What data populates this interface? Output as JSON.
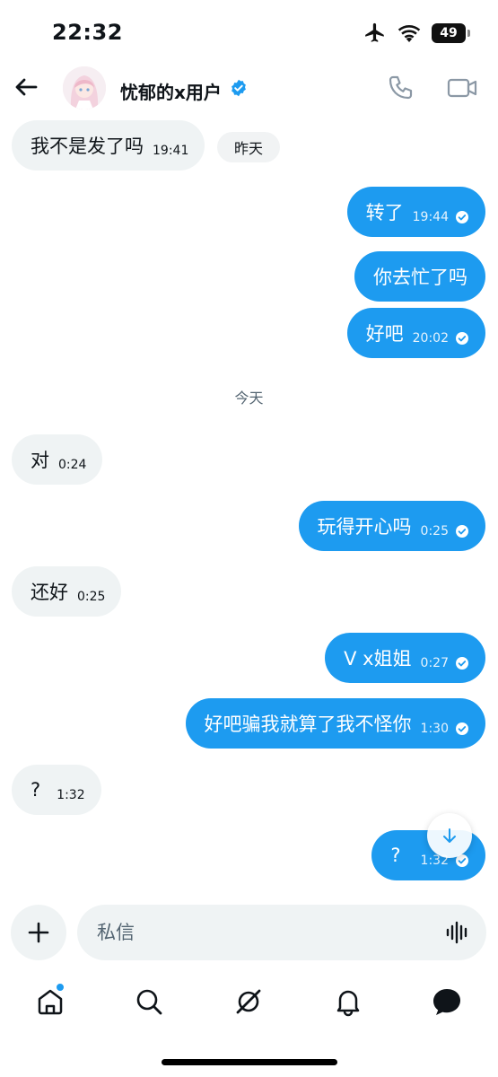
{
  "status_bar": {
    "time": "22:32",
    "battery": "49"
  },
  "header": {
    "contact_name": "忧郁的x用户"
  },
  "chat": {
    "yesterday_label": "昨天",
    "today_label": "今天",
    "messages": [
      {
        "dir": "in",
        "text": "我不是发了吗",
        "time": "19:41"
      },
      {
        "dir": "out",
        "text": "转了",
        "time": "19:44",
        "read": true
      },
      {
        "dir": "out",
        "text": "你去忙了吗",
        "time": "",
        "read": false
      },
      {
        "dir": "out",
        "text": "好吧",
        "time": "20:02",
        "read": true
      },
      {
        "dir": "in",
        "text": "对",
        "time": "0:24"
      },
      {
        "dir": "out",
        "text": "玩得开心吗",
        "time": "0:25",
        "read": true
      },
      {
        "dir": "in",
        "text": "还好",
        "time": "0:25"
      },
      {
        "dir": "out",
        "text": "V x姐姐",
        "time": "0:27",
        "read": true
      },
      {
        "dir": "out",
        "text": "好吧骗我就算了我不怪你",
        "time": "1:30",
        "read": true
      },
      {
        "dir": "in",
        "text": "?",
        "time": "1:32"
      },
      {
        "dir": "out",
        "text": "?",
        "time": "1:32",
        "read": true
      }
    ]
  },
  "composer": {
    "placeholder": "私信"
  },
  "tabs": [
    "home-icon",
    "search-icon",
    "grok-icon",
    "notifications-icon",
    "messages-icon"
  ],
  "colors": {
    "accent": "#1d9bf0",
    "incoming_bubble": "#eff3f4",
    "text": "#0f1419",
    "muted": "#536471"
  }
}
